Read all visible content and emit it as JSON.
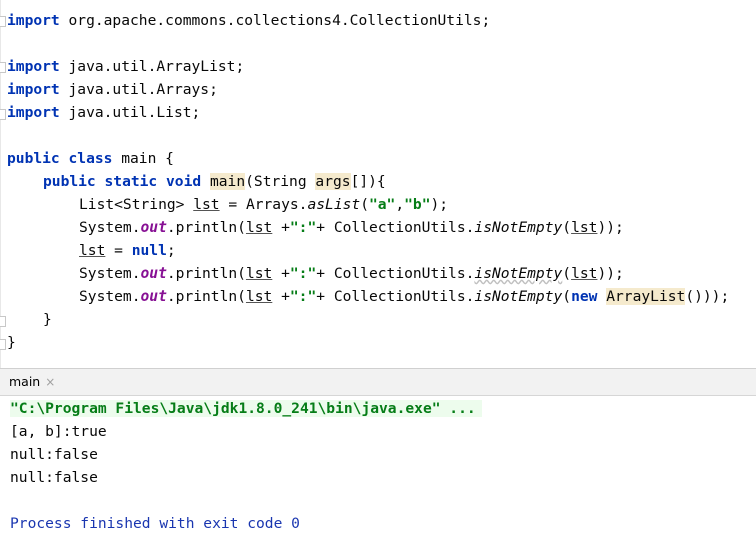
{
  "editor": {
    "import_kw": "import",
    "import_collection_utils": " org.apache.commons.collections4.CollectionUtils;",
    "import_arraylist": " java.util.ArrayList;",
    "import_arrays": " java.util.Arrays;",
    "import_list": " java.util.List;",
    "public_kw": "public",
    "class_kw": " class",
    "class_name": " main {",
    "static_kw": " static",
    "void_kw": " void",
    "method_name": "main",
    "method_params_a": "(String ",
    "method_params_b": "args",
    "method_params_c": "[]){",
    "list_decl_a": "List<String> ",
    "var_lst": "lst",
    "list_decl_b": " = Arrays.",
    "as_list": "asList",
    "paren_open": "(",
    "str_a": "\"a\"",
    "comma": ",",
    "str_b": "\"b\"",
    "paren_close_semi": ");",
    "system": "System.",
    "out": "out",
    "println_open": ".println(",
    "plus_space": " +",
    "colon_str": "\":\"",
    "plus_cu": "+ CollectionUtils.",
    "is_not_empty": "isNotEmpty",
    "close_two": "));",
    "assign_eq": " = ",
    "null_kw": "null",
    "semi": ";",
    "new_kw": "new",
    "space": " ",
    "arraylist_ctor": "ArrayList",
    "close_three": "()));",
    "brace_close": "}"
  },
  "run_panel": {
    "tab_label": "main",
    "tab_close": "×"
  },
  "console": {
    "command": "\"C:\\Program Files\\Java\\jdk1.8.0_241\\bin\\java.exe\" ...",
    "line1": "[a, b]:true",
    "line2": "null:false",
    "line3": "null:false",
    "finished": "Process finished with exit code 0"
  }
}
